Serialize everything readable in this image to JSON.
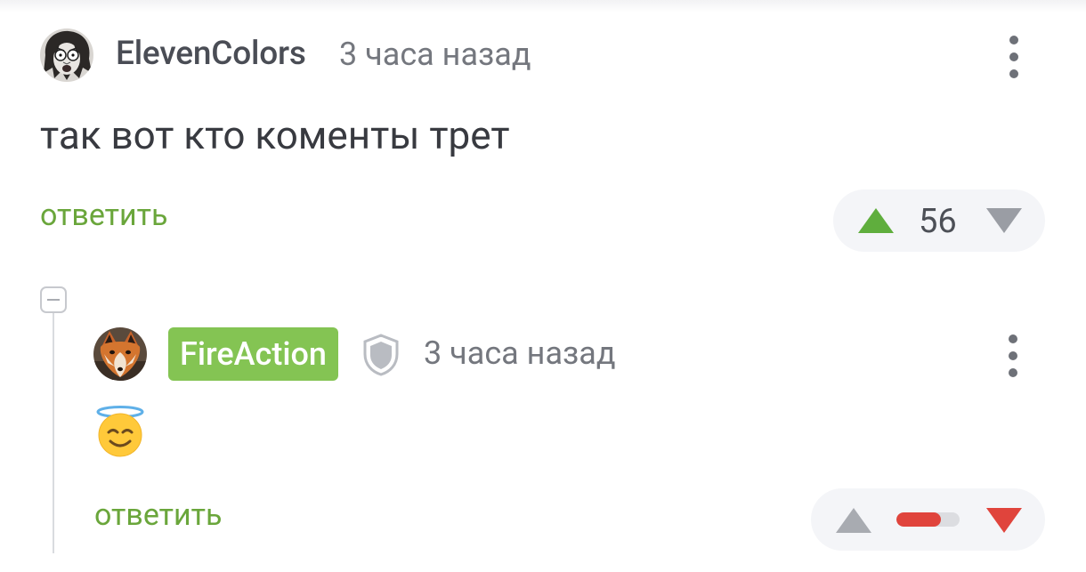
{
  "comment": {
    "author": "ElevenColors",
    "time": "3 часа назад",
    "text": "так вот кто коменты трет",
    "reply_label": "ответить",
    "rating": "56",
    "upvoted": true
  },
  "reply": {
    "author": "FireAction",
    "time": "3 часа назад",
    "emoji_icon": "smiling-face-with-halo-icon",
    "reply_label": "ответить",
    "rating_ratio": 0.7,
    "author_badge_color": "#84c453",
    "downvote_color": "#e0443c"
  },
  "colors": {
    "accent": "#6aa63b",
    "upvote": "#5fae3d",
    "downvote": "#e0443c"
  }
}
